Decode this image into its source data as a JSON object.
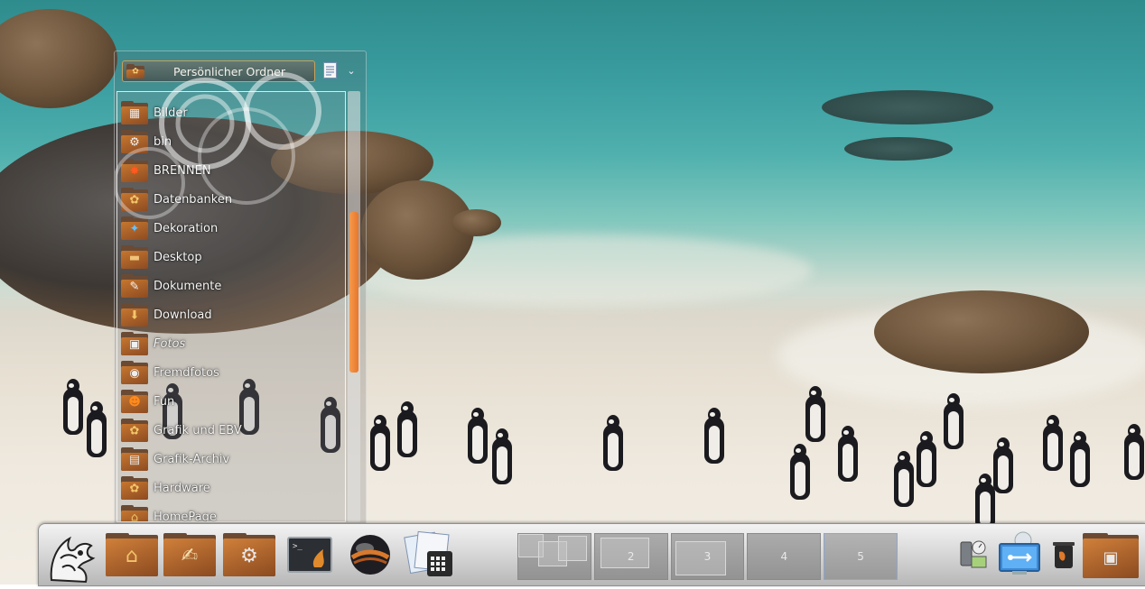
{
  "folder_view": {
    "title": "Persönlicher Ordner",
    "items": [
      {
        "label": "Bilder",
        "icon": "images-folder-icon",
        "italic": false
      },
      {
        "label": "bin",
        "icon": "system-folder-icon",
        "italic": false
      },
      {
        "label": "BRENNEN",
        "icon": "burn-folder-icon",
        "italic": false
      },
      {
        "label": "Datenbanken",
        "icon": "database-folder-icon",
        "italic": false
      },
      {
        "label": "Dekoration",
        "icon": "decoration-folder-icon",
        "italic": false
      },
      {
        "label": "Desktop",
        "icon": "desktop-folder-icon",
        "italic": false
      },
      {
        "label": "Dokumente",
        "icon": "documents-folder-icon",
        "italic": false
      },
      {
        "label": "Download",
        "icon": "download-folder-icon",
        "italic": false
      },
      {
        "label": "Fotos",
        "icon": "photos-link-folder-icon",
        "italic": true
      },
      {
        "label": "Fremdfotos",
        "icon": "camera-folder-icon",
        "italic": false
      },
      {
        "label": "Fun",
        "icon": "pumpkin-folder-icon",
        "italic": false
      },
      {
        "label": "Grafik und EBV",
        "icon": "graphics-folder-icon",
        "italic": false
      },
      {
        "label": "Grafik-Archiv",
        "icon": "archive-folder-icon",
        "italic": false
      },
      {
        "label": "Hardware",
        "icon": "hardware-folder-icon",
        "italic": false
      },
      {
        "label": "HomePage",
        "icon": "homepage-folder-icon",
        "italic": false
      }
    ]
  },
  "panel": {
    "launchers": [
      {
        "icon": "kde-kickoff-icon"
      },
      {
        "icon": "home-folder-icon"
      },
      {
        "icon": "documents-folder-icon"
      },
      {
        "icon": "settings-folder-icon"
      },
      {
        "icon": "terminal-icon"
      },
      {
        "icon": "web-browser-globe-icon"
      },
      {
        "icon": "calendar-contacts-icon"
      }
    ],
    "pager": {
      "desktops": [
        "",
        "2",
        "3",
        "4",
        "5"
      ],
      "active": 5
    },
    "tray": [
      {
        "icon": "system-monitor-icon"
      },
      {
        "icon": "usb-device-notifier-icon"
      },
      {
        "icon": "trash-icon"
      },
      {
        "icon": "photos-folder-icon"
      }
    ]
  },
  "colors": {
    "accent_scroll": "#f08a3c",
    "folder_orange": "#c6772f",
    "panel_gray": "#d9d9d9"
  }
}
